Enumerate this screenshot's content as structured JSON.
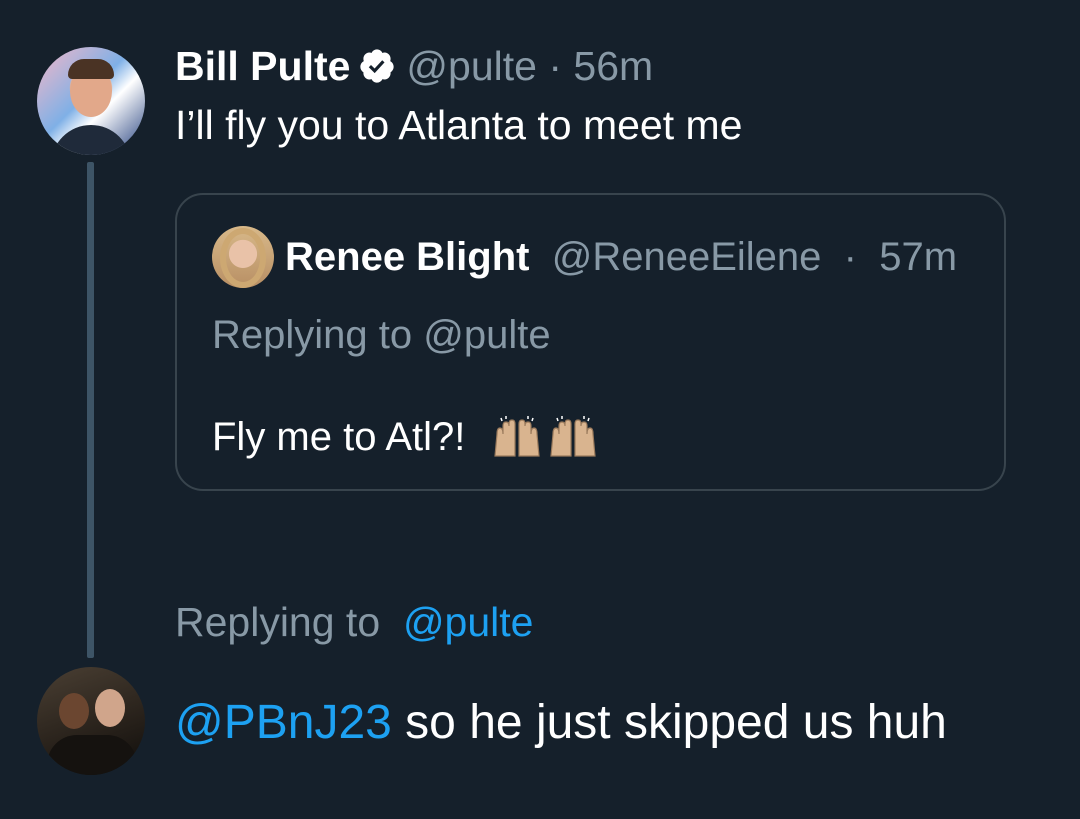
{
  "tweet": {
    "author_name": "Bill Pulte",
    "handle": "@pulte",
    "separator": "·",
    "time": "56m",
    "text": "I’ll fly you to Atlanta to meet me",
    "verified_icon": "verified-badge-icon"
  },
  "quote": {
    "author_name": "Renee Blight",
    "handle": "@ReneeEilene",
    "separator": "·",
    "time": "57m",
    "replying_label": "Replying to @pulte",
    "text": "Fly me to Atl?!",
    "emoji": [
      "raising-hands-emoji",
      "raising-hands-emoji"
    ]
  },
  "reply": {
    "replying_label": "Replying to",
    "replying_handle": "@pulte",
    "mention": "@PBnJ23",
    "text": " so he just skipped us huh"
  },
  "colors": {
    "background": "#15202b",
    "primary_text": "#ffffff",
    "secondary_text": "#8899a6",
    "link": "#1da1f2",
    "border": "#38444d",
    "thread_line": "#3d5466"
  }
}
